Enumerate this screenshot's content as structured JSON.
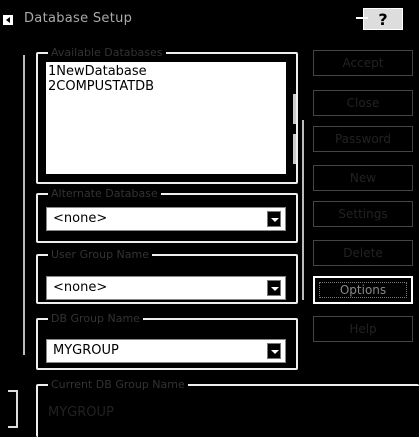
{
  "window": {
    "title": "Database Setup",
    "help_icon": "help-question-icon"
  },
  "database_list": {
    "label": "Available Databases",
    "items": [
      "1NewDatabase",
      "2COMPUSTATDB"
    ]
  },
  "alt_database": {
    "label": "Alternate Database",
    "value": "<none>"
  },
  "user_group": {
    "label": "User Group Name",
    "value": "<none>"
  },
  "db_group": {
    "label": "DB Group Name",
    "value": "MYGROUP"
  },
  "current_group": {
    "label": "Current DB Group Name",
    "value": "MYGROUP"
  },
  "buttons": {
    "accept": "Accept",
    "close": "Close",
    "password": "Password",
    "new": "New",
    "settings": "Settings",
    "delete": "Delete",
    "options": "Options",
    "help": "Help"
  }
}
